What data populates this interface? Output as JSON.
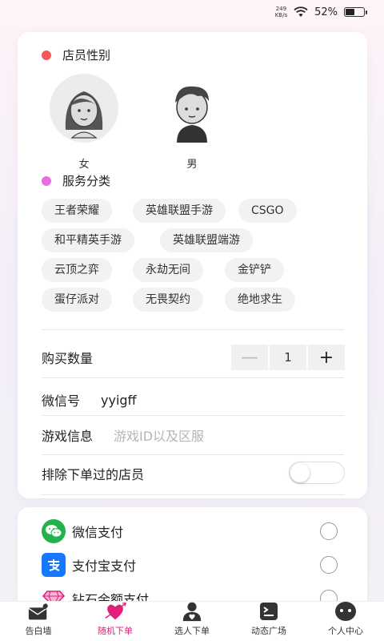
{
  "status_bar": {
    "net_speed_value": "249",
    "net_speed_unit": "KB/s",
    "battery": "52%"
  },
  "gender_section": {
    "title": "店员性别",
    "dot_color": "#f05a5a",
    "options": [
      {
        "label": "女",
        "selected": true
      },
      {
        "label": "男",
        "selected": false
      }
    ]
  },
  "service_section": {
    "title": "服务分类",
    "dot_color": "#e36fe0",
    "chips": [
      "王者荣耀",
      "英雄联盟手游",
      "CSGO",
      "和平精英手游",
      "英雄联盟端游",
      "云顶之弈",
      "永劫无间",
      "金铲铲",
      "蛋仔派对",
      "无畏契约",
      "绝地求生"
    ]
  },
  "form": {
    "quantity_label": "购买数量",
    "quantity_minus": "—",
    "quantity_value": "1",
    "quantity_plus": "+",
    "wechat_label": "微信号",
    "wechat_value": "yyigff",
    "game_info_label": "游戏信息",
    "game_info_placeholder": "游戏ID以及区服",
    "exclude_label": "排除下单过的店员",
    "exclude_on": false
  },
  "payment": {
    "options": [
      {
        "label": "微信支付",
        "icon": "wechat-pay-icon",
        "color": "#22b14c"
      },
      {
        "label": "支付宝支付",
        "icon": "alipay-icon",
        "color": "#1677ff"
      },
      {
        "label": "钻石余额支付",
        "icon": "diamond-icon",
        "color": "#e0207a"
      }
    ]
  },
  "tabbar": {
    "tabs": [
      {
        "label": "告白墙",
        "icon": "envelope-heart-icon"
      },
      {
        "label": "随机下单",
        "icon": "cupid-heart-icon",
        "active": true
      },
      {
        "label": "选人下单",
        "icon": "person-heart-icon"
      },
      {
        "label": "动态广场",
        "icon": "feed-icon"
      },
      {
        "label": "个人中心",
        "icon": "profile-face-icon"
      }
    ],
    "active_color": "#e0207a"
  }
}
